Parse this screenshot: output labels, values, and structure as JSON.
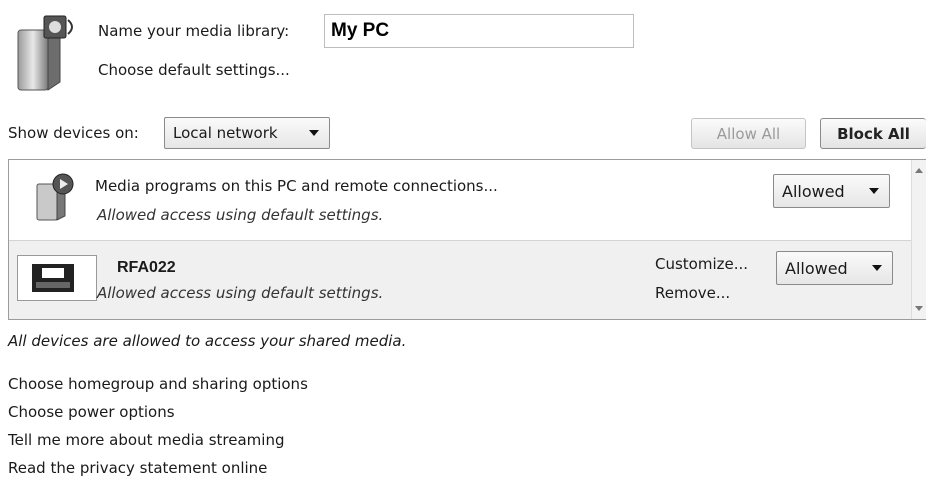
{
  "header": {
    "name_label": "Name your media library:",
    "name_value": "My PC",
    "defaults_link": "Choose default settings..."
  },
  "toolbar": {
    "show_label": "Show devices on:",
    "network_selected": "Local network",
    "allow_all": "Allow All",
    "block_all": "Block All"
  },
  "devices": [
    {
      "title": "Media programs on this PC and remote connections...",
      "subtitle": "Allowed access using default settings.",
      "status": "Allowed"
    },
    {
      "name": "RFA022",
      "subtitle": "Allowed access using default settings.",
      "customize": "Customize...",
      "remove": "Remove...",
      "status": "Allowed"
    }
  ],
  "summary": "All devices are allowed to access your shared media.",
  "links": [
    "Choose homegroup and sharing options",
    "Choose power options",
    "Tell me more about media streaming",
    "Read the privacy statement online"
  ],
  "icons": {
    "library": "media-library-icon",
    "programs": "media-programs-icon",
    "device": "radio-device-icon"
  }
}
